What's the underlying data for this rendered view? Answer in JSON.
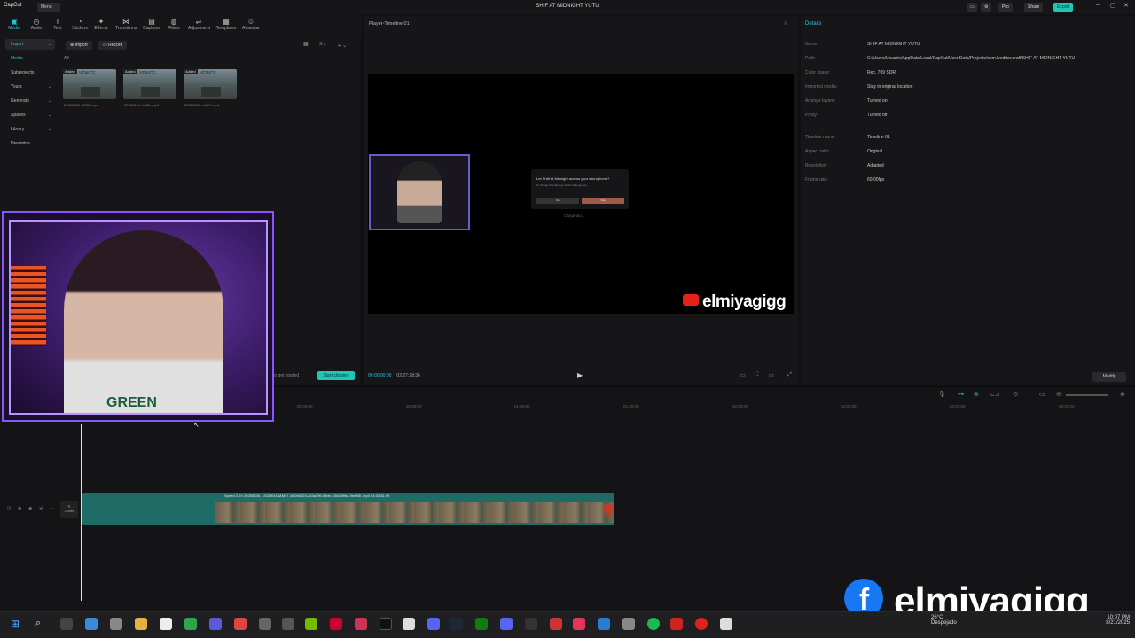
{
  "titlebar": {
    "logo": "CapCut",
    "menu": "Menu",
    "project_title": "SHIF AT MIDNIGHT YUTU",
    "pro": "Pro",
    "share": "Share",
    "export": "Export"
  },
  "toolbar": {
    "items": [
      {
        "label": "Media",
        "icon": "media-icon"
      },
      {
        "label": "Audio",
        "icon": "audio-icon"
      },
      {
        "label": "Text",
        "icon": "text-icon"
      },
      {
        "label": "Stickers",
        "icon": "sticker-icon"
      },
      {
        "label": "Effects",
        "icon": "effects-icon"
      },
      {
        "label": "Transitions",
        "icon": "transitions-icon"
      },
      {
        "label": "Captions",
        "icon": "captions-icon"
      },
      {
        "label": "Filters",
        "icon": "filters-icon"
      },
      {
        "label": "Adjustment",
        "icon": "adjustment-icon"
      },
      {
        "label": "Templates",
        "icon": "templates-icon"
      },
      {
        "label": "AI avatar",
        "icon": "avatar-icon"
      }
    ]
  },
  "leftnav": {
    "items": [
      {
        "label": "Import",
        "selected": true
      },
      {
        "label": "Media",
        "selected": false
      },
      {
        "label": "Subprojects",
        "selected": false
      },
      {
        "label": "Yours",
        "selected": false
      },
      {
        "label": "Generate",
        "selected": false
      },
      {
        "label": "Spaces",
        "selected": false
      },
      {
        "label": "Library",
        "selected": false
      },
      {
        "label": "Dreamina",
        "selected": false
      }
    ]
  },
  "media": {
    "import_btn": "Import",
    "record_btn": "Record",
    "filter_all": "All",
    "badge": "Added",
    "thumb_text": "VENICE",
    "files": [
      "20250826...0530.mp4",
      "20250414...ad5e.mp4",
      "20250408...a9b7.mp4"
    ],
    "hint": "to get started",
    "start_clipping": "Start clipping"
  },
  "player": {
    "title": "Player-Timeline 01",
    "dialog_question": "Let Shift At Midnight access your microphone?",
    "dialog_sub": "To change this later, go to the Settings app.",
    "dialog_no": "No",
    "dialog_yes": "Yes",
    "loading": "Cargando...",
    "watermark": "elmiyagigg",
    "time_current": "00:00:00:00",
    "time_total": "02:27:28:36"
  },
  "details": {
    "title": "Details",
    "rows": [
      {
        "k": "Name:",
        "v": "SHIF AT MIDNIGHT YUTU"
      },
      {
        "k": "Path:",
        "v": "C:/Users/Usuario/AppData/Local/CapCut/User Data/Projects/com.lveditor.draft/SHIF AT MIDNIGHT YUTU"
      },
      {
        "k": "Color space:",
        "v": "Rec. 709 SDR"
      },
      {
        "k": "Imported media:",
        "v": "Stay in original location"
      },
      {
        "k": "Arrange layers:",
        "v": "Turned on"
      },
      {
        "k": "Proxy:",
        "v": "Turned off"
      },
      {
        "k": "Timeline name:",
        "v": "Timeline 01"
      },
      {
        "k": "Aspect ratio:",
        "v": "Original"
      },
      {
        "k": "Resolution:",
        "v": "Adapted"
      },
      {
        "k": "Frame rate:",
        "v": "60.00fps"
      }
    ],
    "modify": "Modify"
  },
  "timeline": {
    "ticks": [
      "00:00:00",
      "00:30:00",
      "01:00:00",
      "01:30:00",
      "02:00:00",
      "02:30:00",
      "03:00:00",
      "03:30:00"
    ],
    "clip_label": "Speed 2.0X  20250826...  20250414AM47-44f2b0623-a53a399-59de-43b2-89ba-9edf58 .mp4  03:34:31:49",
    "cover": "Cover"
  },
  "webcam": {
    "shirt_text": "GREEN"
  },
  "taskbar": {
    "weather_temp": "26°C",
    "weather_desc": "Despejado",
    "time": "10:07 PM",
    "date": "8/21/2025"
  },
  "overlay": {
    "brand": "elmiyagigg"
  }
}
